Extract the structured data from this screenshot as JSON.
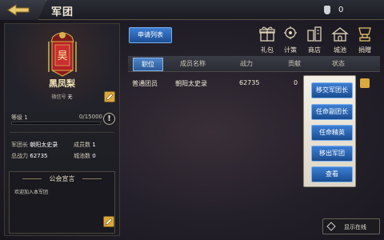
{
  "header": {
    "title": "军团",
    "currency_value": "0"
  },
  "guild": {
    "name": "黑凤梨",
    "wechat_label": "微信号",
    "wechat_value": "无",
    "level_label": "等级",
    "level_value": "1",
    "xp_text": "0/15000",
    "xp_progress": 0,
    "leader_label": "军团长",
    "leader_value": "朝阳太史录",
    "members_label": "成员数",
    "members_value": "1",
    "power_label": "总战力",
    "power_value": "62735",
    "cities_label": "城池数",
    "cities_value": "0",
    "notice_title": "公会宣言",
    "notice_text": "欢迎加入本军团",
    "emblem_char": "昊"
  },
  "toolbar": {
    "apply_list_label": "申请列表",
    "features": [
      {
        "label": "礼包",
        "icon": "gift-icon"
      },
      {
        "label": "计策",
        "icon": "strategy-icon"
      },
      {
        "label": "商店",
        "icon": "shop-icon"
      },
      {
        "label": "城池",
        "icon": "city-icon"
      },
      {
        "label": "捐赠",
        "icon": "donate-icon"
      }
    ]
  },
  "table": {
    "headers": [
      "职位",
      "成员名称",
      "战力",
      "贡献",
      "状态"
    ],
    "rows": [
      {
        "position": "普通团员",
        "name": "朝阳太史录",
        "power": "62735",
        "contribution": "0"
      }
    ]
  },
  "action_menu": {
    "items": [
      "移交军团长",
      "任命副团长",
      "任命精英",
      "移出军团",
      "查看"
    ]
  },
  "footer": {
    "online_label": "显示在线"
  },
  "colors": {
    "accent_blue": "#2f6cc0",
    "gold": "#d8a93c",
    "xp_bar": "#7bb2e8"
  }
}
